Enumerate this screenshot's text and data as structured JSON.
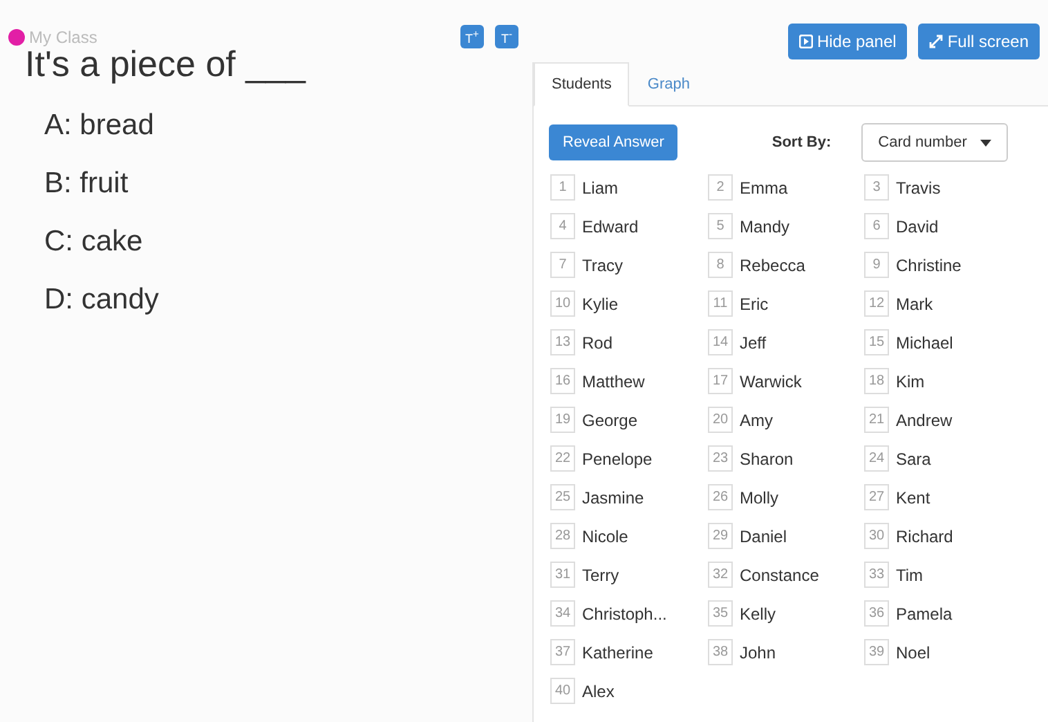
{
  "class_name": {
    "label": "My Class",
    "color": "#e21fa6"
  },
  "text_size_buttons": [
    "T$^{+}$",
    "T$^{-}$"
  ],
  "question": "It's a piece of ___",
  "answers": [
    "A: bread",
    "B: fruit",
    "C: cake",
    "D: candy"
  ],
  "panel_buttons": [
    "Hide panel",
    "Full screen"
  ],
  "tabs": [
    {
      "label": "Students",
      "selected": true
    },
    {
      "label": "Graph",
      "selected": false
    }
  ],
  "reveal_button": "Reveal Answer",
  "sort": {
    "label": "Sort By:",
    "value": "Card number"
  },
  "students": [
    {
      "number": "1",
      "name": "Liam"
    },
    {
      "number": "2",
      "name": "Emma"
    },
    {
      "number": "3",
      "name": "Travis"
    },
    {
      "number": "4",
      "name": "Edward"
    },
    {
      "number": "5",
      "name": "Mandy"
    },
    {
      "number": "6",
      "name": "David"
    },
    {
      "number": "7",
      "name": "Tracy"
    },
    {
      "number": "8",
      "name": "Rebecca"
    },
    {
      "number": "9",
      "name": "Christine"
    },
    {
      "number": "10",
      "name": "Kylie"
    },
    {
      "number": "11",
      "name": "Eric"
    },
    {
      "number": "12",
      "name": "Mark"
    },
    {
      "number": "13",
      "name": "Rod"
    },
    {
      "number": "14",
      "name": "Jeff"
    },
    {
      "number": "15",
      "name": "Michael"
    },
    {
      "number": "16",
      "name": "Matthew"
    },
    {
      "number": "17",
      "name": "Warwick"
    },
    {
      "number": "18",
      "name": "Kim"
    },
    {
      "number": "19",
      "name": "George"
    },
    {
      "number": "20",
      "name": "Amy"
    },
    {
      "number": "21",
      "name": "Andrew"
    },
    {
      "number": "22",
      "name": "Penelope"
    },
    {
      "number": "23",
      "name": "Sharon"
    },
    {
      "number": "24",
      "name": "Sara"
    },
    {
      "number": "25",
      "name": "Jasmine"
    },
    {
      "number": "26",
      "name": "Molly"
    },
    {
      "number": "27",
      "name": "Kent"
    },
    {
      "number": "28",
      "name": "Nicole"
    },
    {
      "number": "29",
      "name": "Daniel"
    },
    {
      "number": "30",
      "name": "Richard"
    },
    {
      "number": "31",
      "name": "Terry"
    },
    {
      "number": "32",
      "name": "Constance"
    },
    {
      "number": "33",
      "name": "Tim"
    },
    {
      "number": "34",
      "name": "Christoph..."
    },
    {
      "number": "35",
      "name": "Kelly"
    },
    {
      "number": "36",
      "name": "Pamela"
    },
    {
      "number": "37",
      "name": "Katherine"
    },
    {
      "number": "38",
      "name": "John"
    },
    {
      "number": "39",
      "name": "Noel"
    },
    {
      "number": "40",
      "name": "Alex"
    }
  ]
}
